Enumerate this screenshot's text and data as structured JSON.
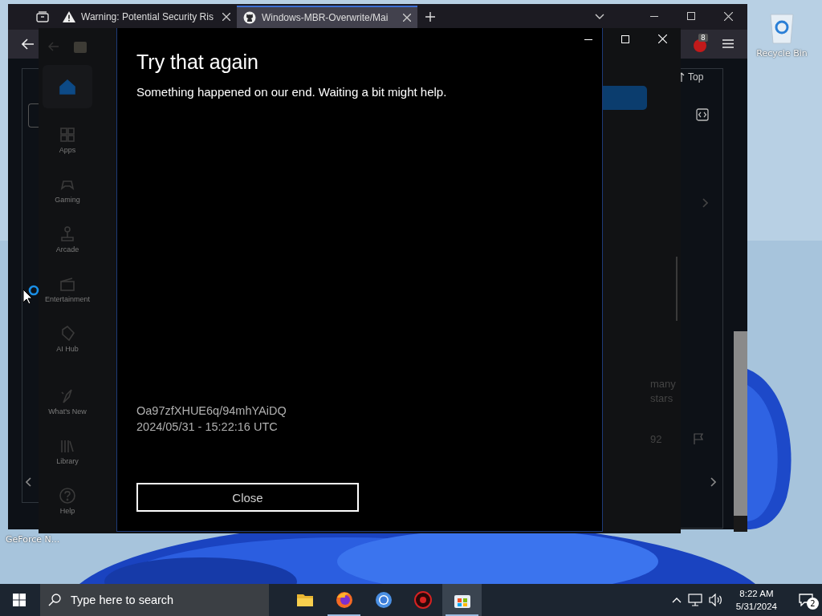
{
  "desktop": {
    "icons": [
      {
        "label": "Recycle Bin"
      },
      {
        "label": "GeForce N..."
      }
    ]
  },
  "browser": {
    "tabs": [
      {
        "title": "Warning: Potential Security Ris",
        "selected": false
      },
      {
        "title": "Windows-MBR-Overwrite/Mai",
        "selected": true
      }
    ],
    "extension_badge": "8",
    "top_link": "Top"
  },
  "store": {
    "sidebar": {
      "items": [
        {
          "selected": true
        },
        {
          "label": "Apps",
          "selected": false
        },
        {
          "label": "Gaming",
          "selected": false
        },
        {
          "label": "Arcade",
          "selected": false
        },
        {
          "label": "Entertainment",
          "selected": false
        },
        {
          "label": "AI Hub",
          "selected": false
        }
      ],
      "bottom_items": [
        {
          "label": "What's New",
          "selected": false
        },
        {
          "label": "Library",
          "selected": false
        },
        {
          "label": "Help",
          "selected": false
        }
      ]
    },
    "behind_texts": [
      "many",
      "stars"
    ],
    "count": "92",
    "dialog": {
      "title": "Try that again",
      "message": "Something happened on our end. Waiting a bit might help.",
      "error_code": "Oa97zfXHUE6q/94mhYAiDQ",
      "timestamp": "2024/05/31 - 15:22:16 UTC",
      "button": "Close"
    }
  },
  "taskbar": {
    "search_placeholder": "Type here to search",
    "apps": [
      {
        "running": false,
        "selected": false
      },
      {
        "running": true,
        "selected": false
      },
      {
        "running": false,
        "selected": false
      },
      {
        "running": false,
        "selected": false
      },
      {
        "running": true,
        "selected": true
      }
    ],
    "time": "8:22 AM",
    "date": "5/31/2024",
    "notification_count": "2"
  }
}
